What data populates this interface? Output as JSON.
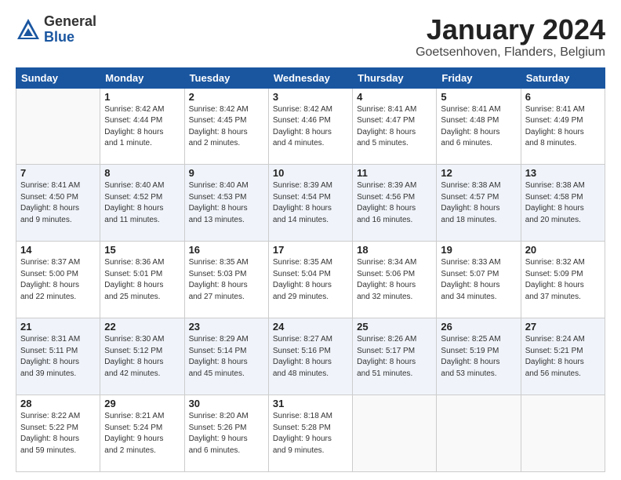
{
  "header": {
    "logo_general": "General",
    "logo_blue": "Blue",
    "month_title": "January 2024",
    "location": "Goetsenhoven, Flanders, Belgium"
  },
  "days_of_week": [
    "Sunday",
    "Monday",
    "Tuesday",
    "Wednesday",
    "Thursday",
    "Friday",
    "Saturday"
  ],
  "weeks": [
    {
      "days": [
        {
          "number": "",
          "info": ""
        },
        {
          "number": "1",
          "info": "Sunrise: 8:42 AM\nSunset: 4:44 PM\nDaylight: 8 hours\nand 1 minute."
        },
        {
          "number": "2",
          "info": "Sunrise: 8:42 AM\nSunset: 4:45 PM\nDaylight: 8 hours\nand 2 minutes."
        },
        {
          "number": "3",
          "info": "Sunrise: 8:42 AM\nSunset: 4:46 PM\nDaylight: 8 hours\nand 4 minutes."
        },
        {
          "number": "4",
          "info": "Sunrise: 8:41 AM\nSunset: 4:47 PM\nDaylight: 8 hours\nand 5 minutes."
        },
        {
          "number": "5",
          "info": "Sunrise: 8:41 AM\nSunset: 4:48 PM\nDaylight: 8 hours\nand 6 minutes."
        },
        {
          "number": "6",
          "info": "Sunrise: 8:41 AM\nSunset: 4:49 PM\nDaylight: 8 hours\nand 8 minutes."
        }
      ]
    },
    {
      "days": [
        {
          "number": "7",
          "info": "Sunrise: 8:41 AM\nSunset: 4:50 PM\nDaylight: 8 hours\nand 9 minutes."
        },
        {
          "number": "8",
          "info": "Sunrise: 8:40 AM\nSunset: 4:52 PM\nDaylight: 8 hours\nand 11 minutes."
        },
        {
          "number": "9",
          "info": "Sunrise: 8:40 AM\nSunset: 4:53 PM\nDaylight: 8 hours\nand 13 minutes."
        },
        {
          "number": "10",
          "info": "Sunrise: 8:39 AM\nSunset: 4:54 PM\nDaylight: 8 hours\nand 14 minutes."
        },
        {
          "number": "11",
          "info": "Sunrise: 8:39 AM\nSunset: 4:56 PM\nDaylight: 8 hours\nand 16 minutes."
        },
        {
          "number": "12",
          "info": "Sunrise: 8:38 AM\nSunset: 4:57 PM\nDaylight: 8 hours\nand 18 minutes."
        },
        {
          "number": "13",
          "info": "Sunrise: 8:38 AM\nSunset: 4:58 PM\nDaylight: 8 hours\nand 20 minutes."
        }
      ]
    },
    {
      "days": [
        {
          "number": "14",
          "info": "Sunrise: 8:37 AM\nSunset: 5:00 PM\nDaylight: 8 hours\nand 22 minutes."
        },
        {
          "number": "15",
          "info": "Sunrise: 8:36 AM\nSunset: 5:01 PM\nDaylight: 8 hours\nand 25 minutes."
        },
        {
          "number": "16",
          "info": "Sunrise: 8:35 AM\nSunset: 5:03 PM\nDaylight: 8 hours\nand 27 minutes."
        },
        {
          "number": "17",
          "info": "Sunrise: 8:35 AM\nSunset: 5:04 PM\nDaylight: 8 hours\nand 29 minutes."
        },
        {
          "number": "18",
          "info": "Sunrise: 8:34 AM\nSunset: 5:06 PM\nDaylight: 8 hours\nand 32 minutes."
        },
        {
          "number": "19",
          "info": "Sunrise: 8:33 AM\nSunset: 5:07 PM\nDaylight: 8 hours\nand 34 minutes."
        },
        {
          "number": "20",
          "info": "Sunrise: 8:32 AM\nSunset: 5:09 PM\nDaylight: 8 hours\nand 37 minutes."
        }
      ]
    },
    {
      "days": [
        {
          "number": "21",
          "info": "Sunrise: 8:31 AM\nSunset: 5:11 PM\nDaylight: 8 hours\nand 39 minutes."
        },
        {
          "number": "22",
          "info": "Sunrise: 8:30 AM\nSunset: 5:12 PM\nDaylight: 8 hours\nand 42 minutes."
        },
        {
          "number": "23",
          "info": "Sunrise: 8:29 AM\nSunset: 5:14 PM\nDaylight: 8 hours\nand 45 minutes."
        },
        {
          "number": "24",
          "info": "Sunrise: 8:27 AM\nSunset: 5:16 PM\nDaylight: 8 hours\nand 48 minutes."
        },
        {
          "number": "25",
          "info": "Sunrise: 8:26 AM\nSunset: 5:17 PM\nDaylight: 8 hours\nand 51 minutes."
        },
        {
          "number": "26",
          "info": "Sunrise: 8:25 AM\nSunset: 5:19 PM\nDaylight: 8 hours\nand 53 minutes."
        },
        {
          "number": "27",
          "info": "Sunrise: 8:24 AM\nSunset: 5:21 PM\nDaylight: 8 hours\nand 56 minutes."
        }
      ]
    },
    {
      "days": [
        {
          "number": "28",
          "info": "Sunrise: 8:22 AM\nSunset: 5:22 PM\nDaylight: 8 hours\nand 59 minutes."
        },
        {
          "number": "29",
          "info": "Sunrise: 8:21 AM\nSunset: 5:24 PM\nDaylight: 9 hours\nand 2 minutes."
        },
        {
          "number": "30",
          "info": "Sunrise: 8:20 AM\nSunset: 5:26 PM\nDaylight: 9 hours\nand 6 minutes."
        },
        {
          "number": "31",
          "info": "Sunrise: 8:18 AM\nSunset: 5:28 PM\nDaylight: 9 hours\nand 9 minutes."
        },
        {
          "number": "",
          "info": ""
        },
        {
          "number": "",
          "info": ""
        },
        {
          "number": "",
          "info": ""
        }
      ]
    }
  ]
}
